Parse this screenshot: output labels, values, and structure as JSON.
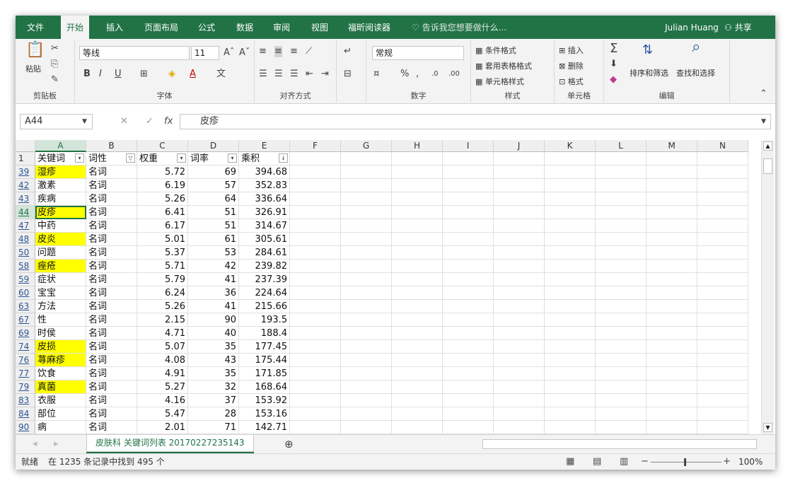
{
  "menu": {
    "tabs": [
      "文件",
      "开始",
      "插入",
      "页面布局",
      "公式",
      "数据",
      "审阅",
      "视图",
      "福昕阅读器"
    ],
    "tell_me": "告诉我您想要做什么...",
    "user": "Julian Huang",
    "share": "共享"
  },
  "ribbon": {
    "clipboard": {
      "label": "剪贴板",
      "paste": "粘贴"
    },
    "font": {
      "label": "字体",
      "name": "等线",
      "size": "11",
      "bold": "B",
      "italic": "I",
      "underline": "U"
    },
    "alignment": {
      "label": "对齐方式"
    },
    "number": {
      "label": "数字",
      "format": "常规"
    },
    "styles": {
      "label": "样式",
      "conditional": "条件格式",
      "table": "套用表格格式",
      "cell": "单元格样式"
    },
    "cells": {
      "label": "单元格",
      "insert": "插入",
      "delete": "删除",
      "format": "格式"
    },
    "editing": {
      "label": "编辑",
      "sort": "排序和筛选",
      "find": "查找和选择"
    }
  },
  "formula_bar": {
    "name_box": "A44",
    "fx": "fx",
    "value": "皮疹"
  },
  "columns": [
    "A",
    "B",
    "C",
    "D",
    "E",
    "F",
    "G",
    "H",
    "I",
    "J",
    "K",
    "L",
    "M",
    "N"
  ],
  "headers": [
    "关键词",
    "词性",
    "权重",
    "词率",
    "乘积"
  ],
  "rows": [
    {
      "n": "39",
      "kw": "湿疹",
      "pos": "名词",
      "w": "5.72",
      "r": "69",
      "p": "394.68",
      "hl": true
    },
    {
      "n": "42",
      "kw": "激素",
      "pos": "名词",
      "w": "6.19",
      "r": "57",
      "p": "352.83",
      "hl": false
    },
    {
      "n": "43",
      "kw": "疾病",
      "pos": "名词",
      "w": "5.26",
      "r": "64",
      "p": "336.64",
      "hl": false
    },
    {
      "n": "44",
      "kw": "皮疹",
      "pos": "名词",
      "w": "6.41",
      "r": "51",
      "p": "326.91",
      "hl": true
    },
    {
      "n": "47",
      "kw": "中药",
      "pos": "名词",
      "w": "6.17",
      "r": "51",
      "p": "314.67",
      "hl": false
    },
    {
      "n": "48",
      "kw": "皮炎",
      "pos": "名词",
      "w": "5.01",
      "r": "61",
      "p": "305.61",
      "hl": true
    },
    {
      "n": "50",
      "kw": "问题",
      "pos": "名词",
      "w": "5.37",
      "r": "53",
      "p": "284.61",
      "hl": false
    },
    {
      "n": "58",
      "kw": "痤疮",
      "pos": "名词",
      "w": "5.71",
      "r": "42",
      "p": "239.82",
      "hl": true
    },
    {
      "n": "59",
      "kw": "症状",
      "pos": "名词",
      "w": "5.79",
      "r": "41",
      "p": "237.39",
      "hl": false
    },
    {
      "n": "60",
      "kw": "宝宝",
      "pos": "名词",
      "w": "6.24",
      "r": "36",
      "p": "224.64",
      "hl": false
    },
    {
      "n": "63",
      "kw": "方法",
      "pos": "名词",
      "w": "5.26",
      "r": "41",
      "p": "215.66",
      "hl": false
    },
    {
      "n": "67",
      "kw": "性",
      "pos": "名词",
      "w": "2.15",
      "r": "90",
      "p": "193.5",
      "hl": false
    },
    {
      "n": "69",
      "kw": "时侯",
      "pos": "名词",
      "w": "4.71",
      "r": "40",
      "p": "188.4",
      "hl": false
    },
    {
      "n": "74",
      "kw": "皮损",
      "pos": "名词",
      "w": "5.07",
      "r": "35",
      "p": "177.45",
      "hl": true
    },
    {
      "n": "76",
      "kw": "荨麻疹",
      "pos": "名词",
      "w": "4.08",
      "r": "43",
      "p": "175.44",
      "hl": true
    },
    {
      "n": "77",
      "kw": "饮食",
      "pos": "名词",
      "w": "4.91",
      "r": "35",
      "p": "171.85",
      "hl": false
    },
    {
      "n": "79",
      "kw": "真菌",
      "pos": "名词",
      "w": "5.27",
      "r": "32",
      "p": "168.64",
      "hl": true
    },
    {
      "n": "83",
      "kw": "衣服",
      "pos": "名词",
      "w": "4.16",
      "r": "37",
      "p": "153.92",
      "hl": false
    },
    {
      "n": "84",
      "kw": "部位",
      "pos": "名词",
      "w": "5.47",
      "r": "28",
      "p": "153.16",
      "hl": false
    },
    {
      "n": "90",
      "kw": "病",
      "pos": "名词",
      "w": "2.01",
      "r": "71",
      "p": "142.71",
      "hl": false
    }
  ],
  "selected_row": "44",
  "sheet_tab": "皮肤科 关键词列表 20170227235143",
  "status": {
    "ready": "就绪",
    "message": "在 1235 条记录中找到 495 个",
    "zoom": "100%"
  }
}
